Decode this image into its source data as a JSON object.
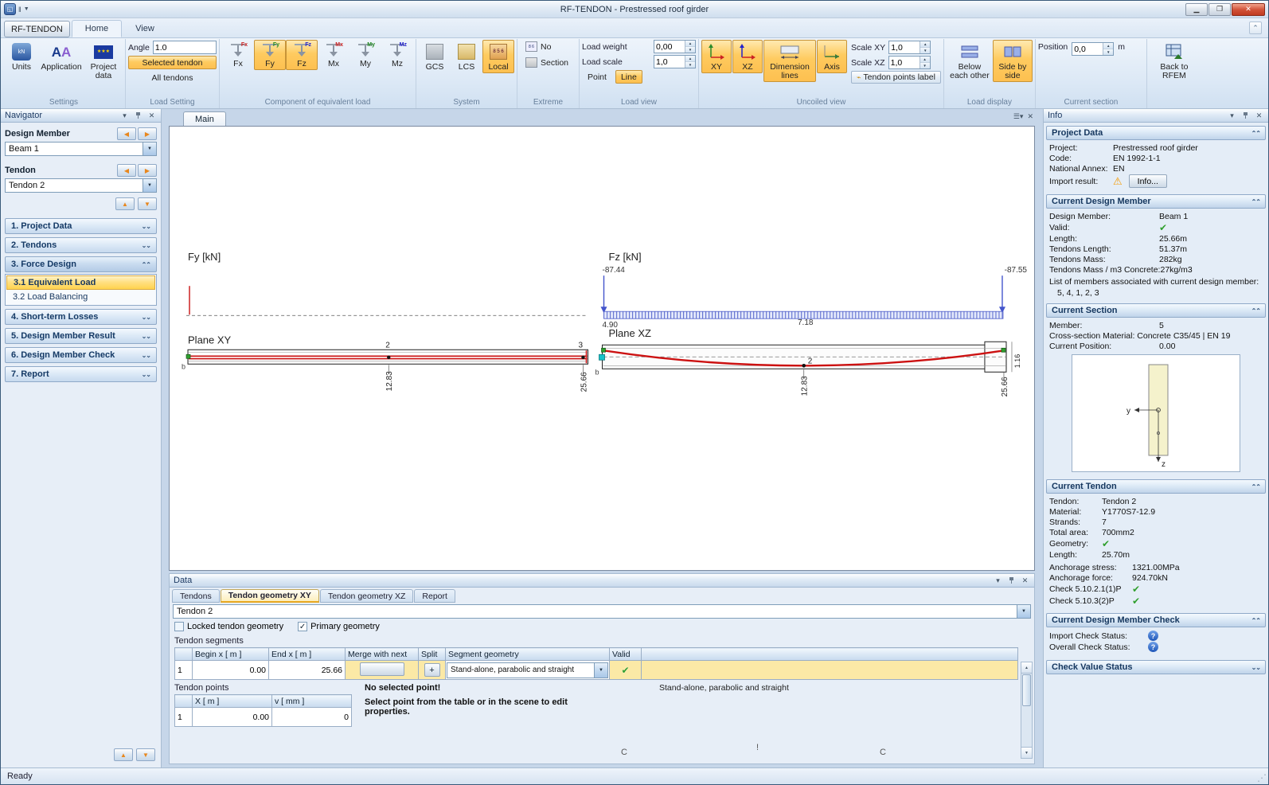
{
  "window": {
    "title": "RF-TENDON - Prestressed roof girder",
    "app_button": "RF-TENDON",
    "tab_home": "Home",
    "tab_view": "View",
    "status": "Ready"
  },
  "ribbon": {
    "settings": {
      "label": "Settings",
      "units": "Units",
      "units_icon_text": "kN",
      "application": "Application",
      "project_data": "Project data"
    },
    "load_setting": {
      "label": "Load Setting",
      "angle_label": "Angle",
      "angle_value": "1.0",
      "selected_tendon": "Selected tendon",
      "all_tendons": "All tendons"
    },
    "component": {
      "label": "Component of equivalent load",
      "fx": "Fx",
      "fy": "Fy",
      "fz": "Fz",
      "mx": "Mx",
      "my": "My",
      "mz": "Mz"
    },
    "system": {
      "label": "System",
      "gcs": "GCS",
      "lcs": "LCS",
      "local": "Local"
    },
    "extreme": {
      "label": "Extreme",
      "no": "No",
      "section": "Section"
    },
    "load_view": {
      "label": "Load view",
      "load_weight_label": "Load weight",
      "load_weight_value": "0,00",
      "load_scale_label": "Load scale",
      "load_scale_value": "1,0",
      "point": "Point",
      "line": "Line"
    },
    "uncoiled_view": {
      "label": "Uncoiled view",
      "xy": "XY",
      "xz": "XZ",
      "dimension_lines": "Dimension lines",
      "axis": "Axis",
      "scale_xy_label": "Scale XY",
      "scale_xy_value": "1,0",
      "scale_xz_label": "Scale XZ",
      "scale_xz_value": "1,0",
      "tendon_points_label": "Tendon points label"
    },
    "load_display": {
      "label": "Load display",
      "below_each_other": "Below each other",
      "side_by_side": "Side by side"
    },
    "current_section": {
      "label": "Current section",
      "position_label": "Position",
      "position_value": "0,0",
      "unit": "m"
    },
    "back_to_rfem": "Back to RFEM"
  },
  "navigator": {
    "title": "Navigator",
    "design_member_label": "Design Member",
    "design_member_value": "Beam 1",
    "tendon_label": "Tendon",
    "tendon_value": "Tendon 2",
    "sections": [
      {
        "label": "1. Project Data"
      },
      {
        "label": "2. Tendons"
      },
      {
        "label": "3. Force Design"
      },
      {
        "label": "4. Short-term Losses"
      },
      {
        "label": "5. Design Member Result"
      },
      {
        "label": "6. Design Member Check"
      },
      {
        "label": "7. Report"
      }
    ],
    "force_design_children": [
      {
        "label": "3.1 Equivalent Load"
      },
      {
        "label": "3.2 Load Balancing"
      }
    ]
  },
  "canvas": {
    "tab": "Main",
    "fy_title": "Fy [kN]",
    "fz_title": "Fz [kN]",
    "plane_xy": "Plane XY",
    "plane_xz": "Plane XZ",
    "fz_left": "-87.44",
    "fz_right": "-87.55",
    "dim_left": "4.90",
    "dim_mid": "7.18",
    "xy_point_2": "2",
    "xy_point_3": "3",
    "xy_dim_mid": "12.83",
    "xy_dim_end": "25.66",
    "xy_b": "b",
    "xz_point_2": "2",
    "xz_dim_mid": "12.83",
    "xz_dim_end": "25.66",
    "xz_dim_height": "1.16",
    "xz_b": "b"
  },
  "data_panel": {
    "title": "Data",
    "tab_tendons": "Tendons",
    "tab_geometry_xy": "Tendon geometry XY",
    "tab_geometry_xz": "Tendon geometry XZ",
    "tab_report": "Report",
    "tendon_select": "Tendon 2",
    "locked_label": "Locked tendon geometry",
    "primary_label": "Primary geometry",
    "segments_title": "Tendon segments",
    "seg_col_begin": "Begin x  [ m ]",
    "seg_col_end": "End x  [ m ]",
    "seg_col_merge": "Merge with next",
    "seg_col_split": "Split",
    "seg_col_geometry": "Segment geometry",
    "seg_col_valid": "Valid",
    "seg_row_num": "1",
    "seg_row_begin": "0.00",
    "seg_row_end": "25.66",
    "seg_row_split": "+",
    "seg_row_geometry": "Stand-alone, parabolic and straight",
    "points_title": "Tendon points",
    "pt_col_x": "X  [ m ]",
    "pt_col_v": "v  [ mm ]",
    "pt_row_num": "1",
    "pt_row_x": "0.00",
    "pt_row_v": "0",
    "no_selection_title": "No selected point!",
    "no_selection_text": "Select point from the table or in the scene to edit properties.",
    "geometry_hint": "Stand-alone, parabolic and straight",
    "artifact_left": "C",
    "artifact_mid": "!",
    "artifact_right": "C"
  },
  "info": {
    "title": "Info",
    "project_data": {
      "header": "Project Data",
      "project_label": "Project:",
      "project_value": "Prestressed roof girder",
      "code_label": "Code:",
      "code_value": "EN 1992-1-1",
      "annex_label": "National Annex:",
      "annex_value": "EN",
      "import_label": "Import result:",
      "info_button": "Info..."
    },
    "design_member": {
      "header": "Current Design Member",
      "dm_label": "Design Member:",
      "dm_value": "Beam 1",
      "valid_label": "Valid:",
      "length_label": "Length:",
      "length_value": "25.66m",
      "tlength_label": "Tendons Length:",
      "tlength_value": "51.37m",
      "tmass_label": "Tendons Mass:",
      "tmass_value": "282kg",
      "tmassm3_label": "Tendons Mass / m3 Concrete:",
      "tmassm3_value": "27kg/m3",
      "list_label": "List of members associated with current design member:",
      "list_value": "5, 4, 1, 2, 3"
    },
    "section": {
      "header": "Current Section",
      "member_label": "Member:",
      "member_value": "5",
      "material_label": "Cross-section Material:",
      "material_value": "Concrete C35/45 | EN 19",
      "position_label": "Current Position:",
      "position_value": "0.00",
      "axis_y": "y",
      "axis_z": "z"
    },
    "tendon": {
      "header": "Current Tendon",
      "tendon_label": "Tendon:",
      "tendon_value": "Tendon 2",
      "material_label": "Material:",
      "material_value": "Y1770S7-12.9",
      "strands_label": "Strands:",
      "strands_value": "7",
      "area_label": "Total area:",
      "area_value": "700mm2",
      "geometry_label": "Geometry:",
      "length_label": "Length:",
      "length_value": "25.70m",
      "stress_label": "Anchorage stress:",
      "stress_value": "1321.00MPa",
      "force_label": "Anchorage force:",
      "force_value": "924.70kN",
      "check1": "Check 5.10.2.1(1)P",
      "check2": "Check 5.10.3(2)P"
    },
    "member_check": {
      "header": "Current Design Member Check",
      "import_label": "Import Check Status:",
      "overall_label": "Overall Check Status:",
      "value_status": "Check Value Status"
    }
  }
}
